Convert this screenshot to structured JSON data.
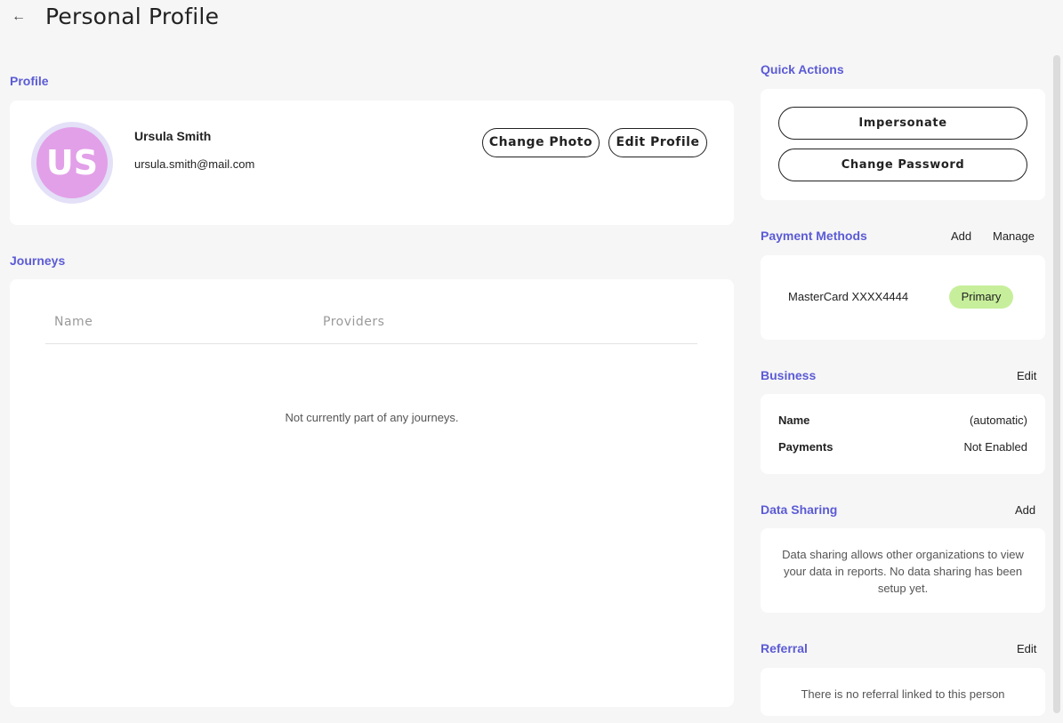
{
  "header": {
    "back_icon": "arrow-left-icon",
    "title": "Personal Profile"
  },
  "profile": {
    "section_label": "Profile",
    "initials": "US",
    "name": "Ursula Smith",
    "email": "ursula.smith@mail.com",
    "change_photo_label": "Change Photo",
    "edit_profile_label": "Edit Profile",
    "avatar_color": "#e2a0e8"
  },
  "journeys": {
    "section_label": "Journeys",
    "columns": [
      "Name",
      "Providers"
    ],
    "empty_message": "Not currently part of any journeys."
  },
  "quick_actions": {
    "section_label": "Quick Actions",
    "impersonate_label": "Impersonate",
    "change_password_label": "Change Password"
  },
  "payment_methods": {
    "section_label": "Payment Methods",
    "add_label": "Add",
    "manage_label": "Manage",
    "card_label": "MasterCard XXXX4444",
    "badge": "Primary",
    "badge_color": "#c7ef9b"
  },
  "business": {
    "section_label": "Business",
    "edit_label": "Edit",
    "rows": [
      {
        "label": "Name",
        "value": "(automatic)"
      },
      {
        "label": "Payments",
        "value": "Not Enabled"
      }
    ]
  },
  "data_sharing": {
    "section_label": "Data Sharing",
    "add_label": "Add",
    "description": "Data sharing allows other organizations to view your data in reports. No data sharing has been setup yet."
  },
  "referral": {
    "section_label": "Referral",
    "edit_label": "Edit",
    "message": "There is no referral linked to this person"
  },
  "theme": {
    "accent": "#5b5bd6",
    "background": "#f6f6f6"
  }
}
